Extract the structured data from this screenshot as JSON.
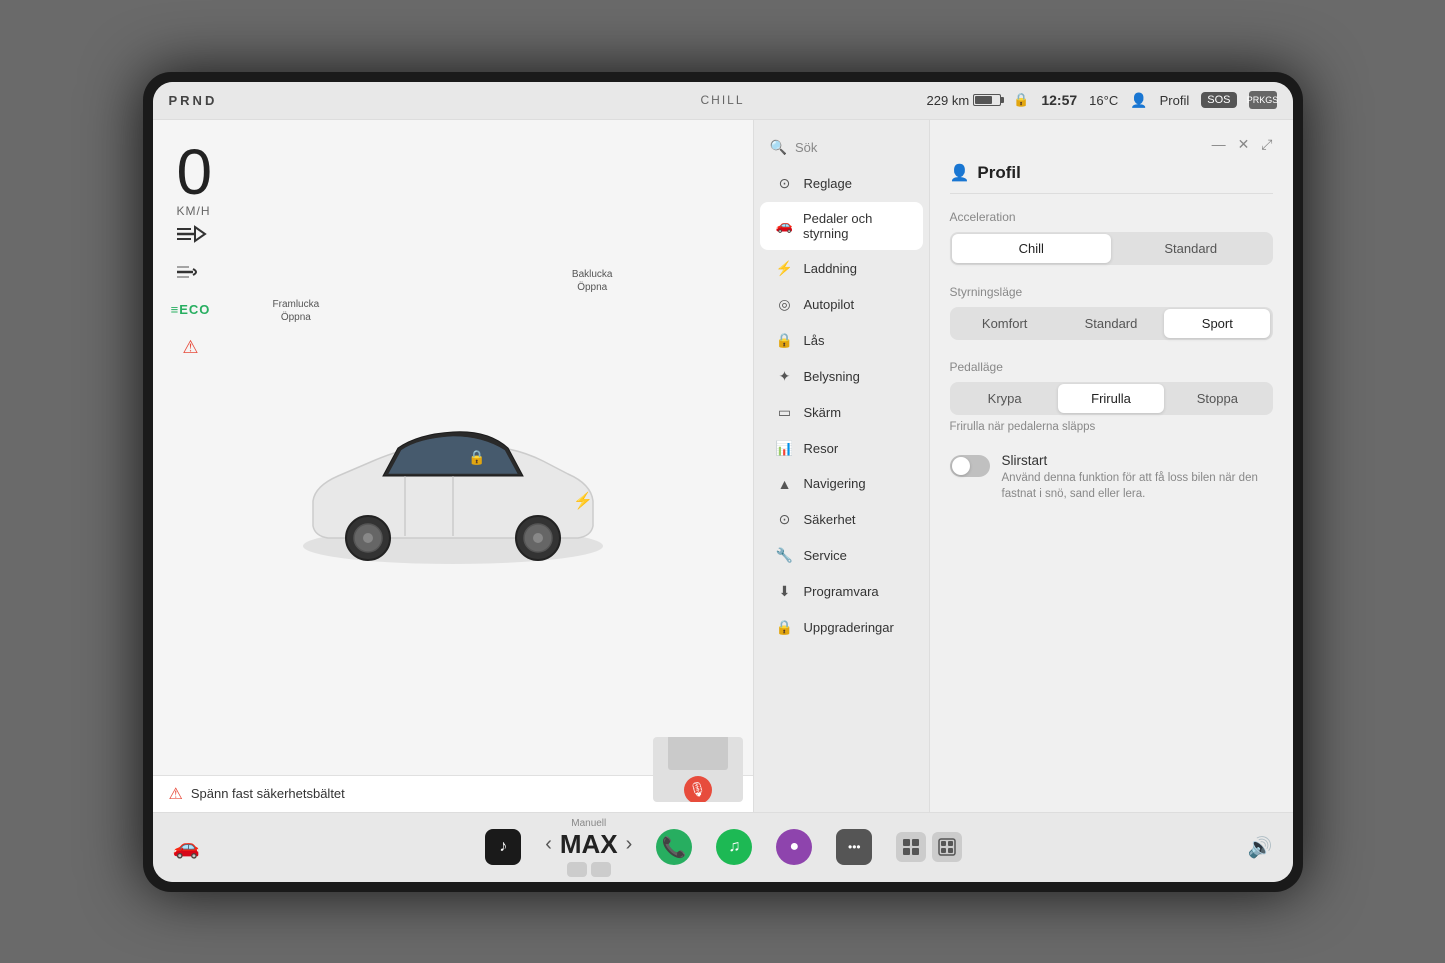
{
  "screen": {
    "statusBar": {
      "prnd": "PRND",
      "chill": "CHILL",
      "battery_km": "229 km",
      "time": "12:57",
      "temp": "16°C",
      "profile": "Profil",
      "lock_icon": "🔒",
      "sos": "SOS"
    },
    "carView": {
      "speed": "0",
      "speed_unit": "KM/H",
      "door_front_label": "Framlucka\nÖppna",
      "door_rear_label": "Baklucka\nÖppna",
      "alert_text": "Spänn fast säkerhetsbältet"
    },
    "menu": {
      "search_placeholder": "Sök",
      "items": [
        {
          "id": "reglage",
          "label": "Reglage",
          "icon": "⊙"
        },
        {
          "id": "pedaler",
          "label": "Pedaler och styrning",
          "icon": "🚗",
          "active": true
        },
        {
          "id": "laddning",
          "label": "Laddning",
          "icon": "⚡"
        },
        {
          "id": "autopilot",
          "label": "Autopilot",
          "icon": "◎"
        },
        {
          "id": "las",
          "label": "Lås",
          "icon": "🔒"
        },
        {
          "id": "belysning",
          "label": "Belysning",
          "icon": "✦"
        },
        {
          "id": "skarm",
          "label": "Skärm",
          "icon": "▭"
        },
        {
          "id": "resor",
          "label": "Resor",
          "icon": "📊"
        },
        {
          "id": "navigering",
          "label": "Navigering",
          "icon": "▲"
        },
        {
          "id": "sakerhet",
          "label": "Säkerhet",
          "icon": "⊙"
        },
        {
          "id": "service",
          "label": "Service",
          "icon": "🔧"
        },
        {
          "id": "programvara",
          "label": "Programvara",
          "icon": "⬇"
        },
        {
          "id": "uppgraderingar",
          "label": "Uppgraderingar",
          "icon": "🔒"
        }
      ]
    },
    "settings": {
      "title": "Profil",
      "profile_icon": "👤",
      "sections": {
        "acceleration": {
          "label": "Acceleration",
          "options": [
            "Chill",
            "Standard"
          ],
          "selected": "Chill"
        },
        "styrningslage": {
          "label": "Styrningsläge",
          "options": [
            "Komfort",
            "Standard",
            "Sport"
          ],
          "selected": "Sport"
        },
        "pedallage": {
          "label": "Pedalläge",
          "options": [
            "Krypa",
            "Frirulla",
            "Stoppa"
          ],
          "selected": "Frirulla",
          "note": "Frirulla när pedalerna släpps"
        },
        "slirstart": {
          "label": "Slirstart",
          "description": "Använd denna funktion för att få loss bilen när den fastnat i snö, sand eller lera.",
          "enabled": false
        }
      }
    },
    "taskbar": {
      "gear_label": "Manuell",
      "gear": "MAX",
      "arrow_left": "‹",
      "arrow_right": "›",
      "apps": [
        {
          "id": "music",
          "label": "Music",
          "icon": "♪"
        },
        {
          "id": "phone",
          "label": "Phone",
          "icon": "📞"
        },
        {
          "id": "spotify",
          "label": "Spotify",
          "icon": "♫"
        },
        {
          "id": "camera",
          "label": "Camera",
          "icon": "●"
        },
        {
          "id": "more",
          "label": "More",
          "icon": "•••"
        }
      ],
      "volume_icon": "🔊"
    }
  }
}
